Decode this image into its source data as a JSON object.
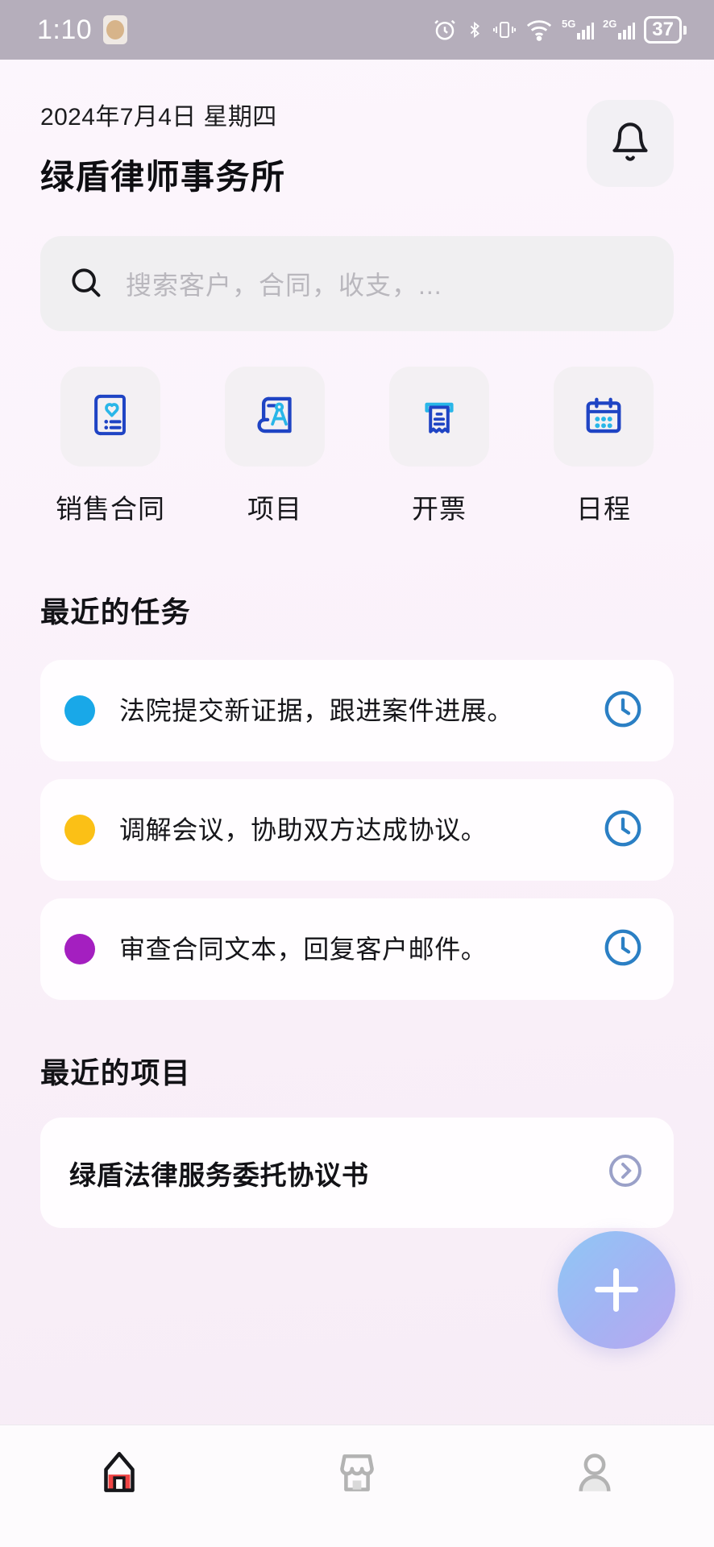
{
  "status_bar": {
    "time": "1:10",
    "battery_level": "37",
    "icons": [
      "alarm-icon",
      "bluetooth-icon",
      "vibrate-icon",
      "wifi-icon",
      "signal-5g-icon",
      "signal-2g-icon",
      "battery-icon"
    ]
  },
  "header": {
    "date": "2024年7月4日 星期四",
    "title": "绿盾律师事务所",
    "notification_icon": "bell-icon"
  },
  "search": {
    "placeholder": "搜索客户，合同，收支，...",
    "icon": "search-icon"
  },
  "quick_actions": [
    {
      "label": "销售合同",
      "icon": "contract-heart-icon"
    },
    {
      "label": "项目",
      "icon": "blueprint-compass-icon"
    },
    {
      "label": "开票",
      "icon": "invoice-receipt-icon"
    },
    {
      "label": "日程",
      "icon": "calendar-icon"
    }
  ],
  "tasks_section": {
    "title": "最近的任务",
    "items": [
      {
        "text": "法院提交新证据，跟进案件进展。",
        "dot_color": "#19a8e8",
        "action_icon": "clock-icon"
      },
      {
        "text": "调解会议，协助双方达成协议。",
        "dot_color": "#fbc016",
        "action_icon": "clock-icon"
      },
      {
        "text": "审查合同文本，回复客户邮件。",
        "dot_color": "#a41fc0",
        "action_icon": "clock-icon"
      }
    ]
  },
  "projects_section": {
    "title": "最近的项目",
    "items": [
      {
        "name": "绿盾法律服务委托协议书",
        "action_icon": "chevron-right-icon"
      }
    ]
  },
  "fab": {
    "icon": "plus-icon"
  },
  "bottom_nav": [
    {
      "icon": "home-icon",
      "active": true
    },
    {
      "icon": "store-icon",
      "active": false
    },
    {
      "icon": "profile-icon",
      "active": false
    }
  ],
  "colors": {
    "accent_blue": "#1f56c4",
    "accent_cyan": "#29b6e8",
    "page_bg": "#fbf4fb",
    "card_bg": "#fffdff",
    "tile_bg": "#f3f0f3",
    "status_bar_bg": "#b5aebb",
    "home_active": "#ef4444"
  }
}
